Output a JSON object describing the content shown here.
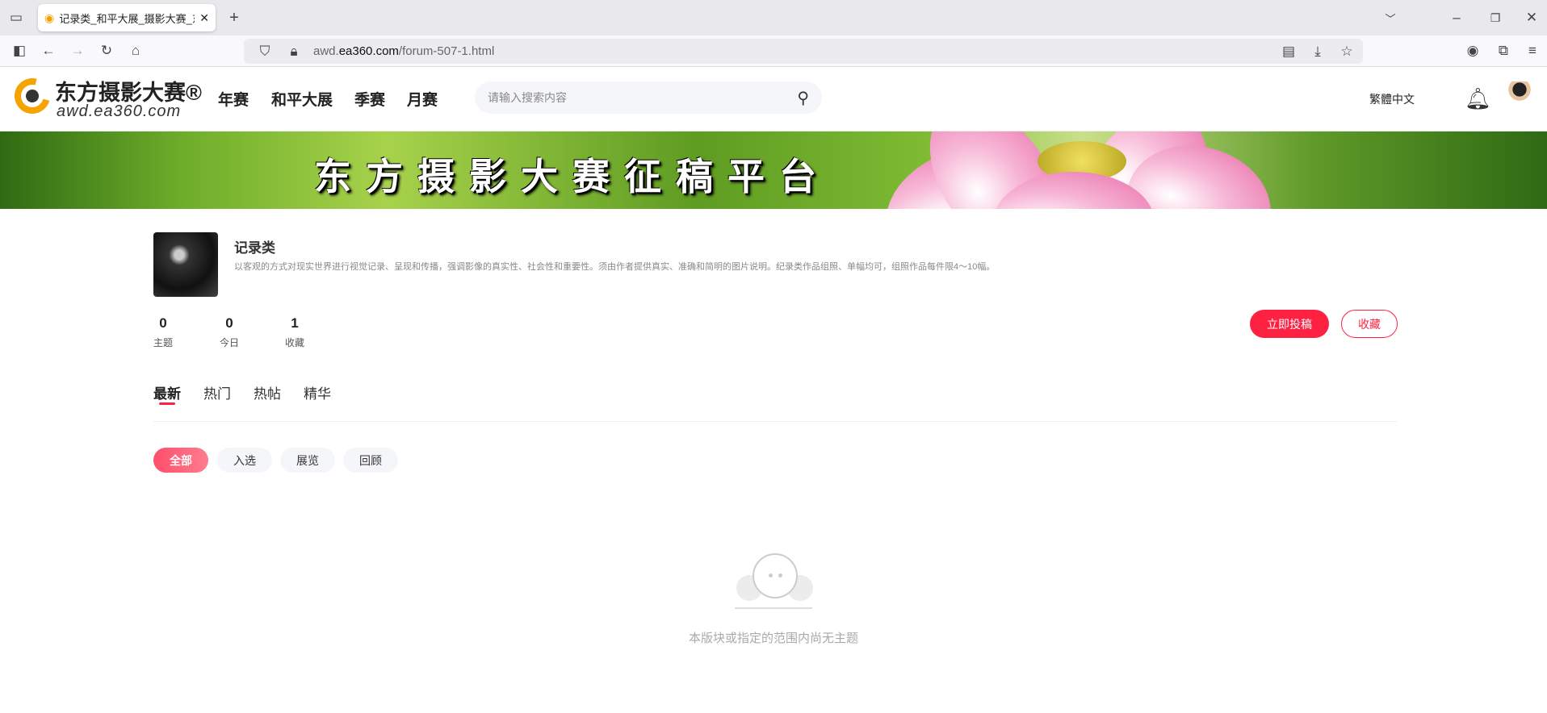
{
  "browser": {
    "tab_title": "记录类_和平大展_摄影大赛_东方",
    "url_prefix": "awd.",
    "url_domain": "ea360.com",
    "url_path": "/forum-507-1.html"
  },
  "site": {
    "logo_text": "东方摄影大赛®",
    "logo_sub": "awd.ea360.com",
    "nav": [
      "年赛",
      "和平大展",
      "季赛",
      "月赛"
    ],
    "search_placeholder": "请输入搜索内容",
    "language": "繁體中文"
  },
  "banner": {
    "title": "东方摄影大赛征稿平台"
  },
  "forum": {
    "name": "记录类",
    "description": "以客观的方式对现实世界进行视觉记录、呈现和传播，强调影像的真实性、社会性和重要性。须由作者提供真实、准确和简明的图片说明。纪录类作品组照、单幅均可，组照作品每件限4～10幅。",
    "stats": [
      {
        "value": "0",
        "label": "主题"
      },
      {
        "value": "0",
        "label": "今日"
      },
      {
        "value": "1",
        "label": "收藏"
      }
    ],
    "submit_label": "立即投稿",
    "favorite_label": "收藏"
  },
  "tabs": {
    "items": [
      "最新",
      "热门",
      "热帖",
      "精华"
    ],
    "active": 0
  },
  "filters": {
    "items": [
      "全部",
      "入选",
      "展览",
      "回顾"
    ],
    "active": 0
  },
  "empty": {
    "message": "本版块或指定的范围内尚无主题"
  },
  "colors": {
    "accent": "#ff2142"
  }
}
